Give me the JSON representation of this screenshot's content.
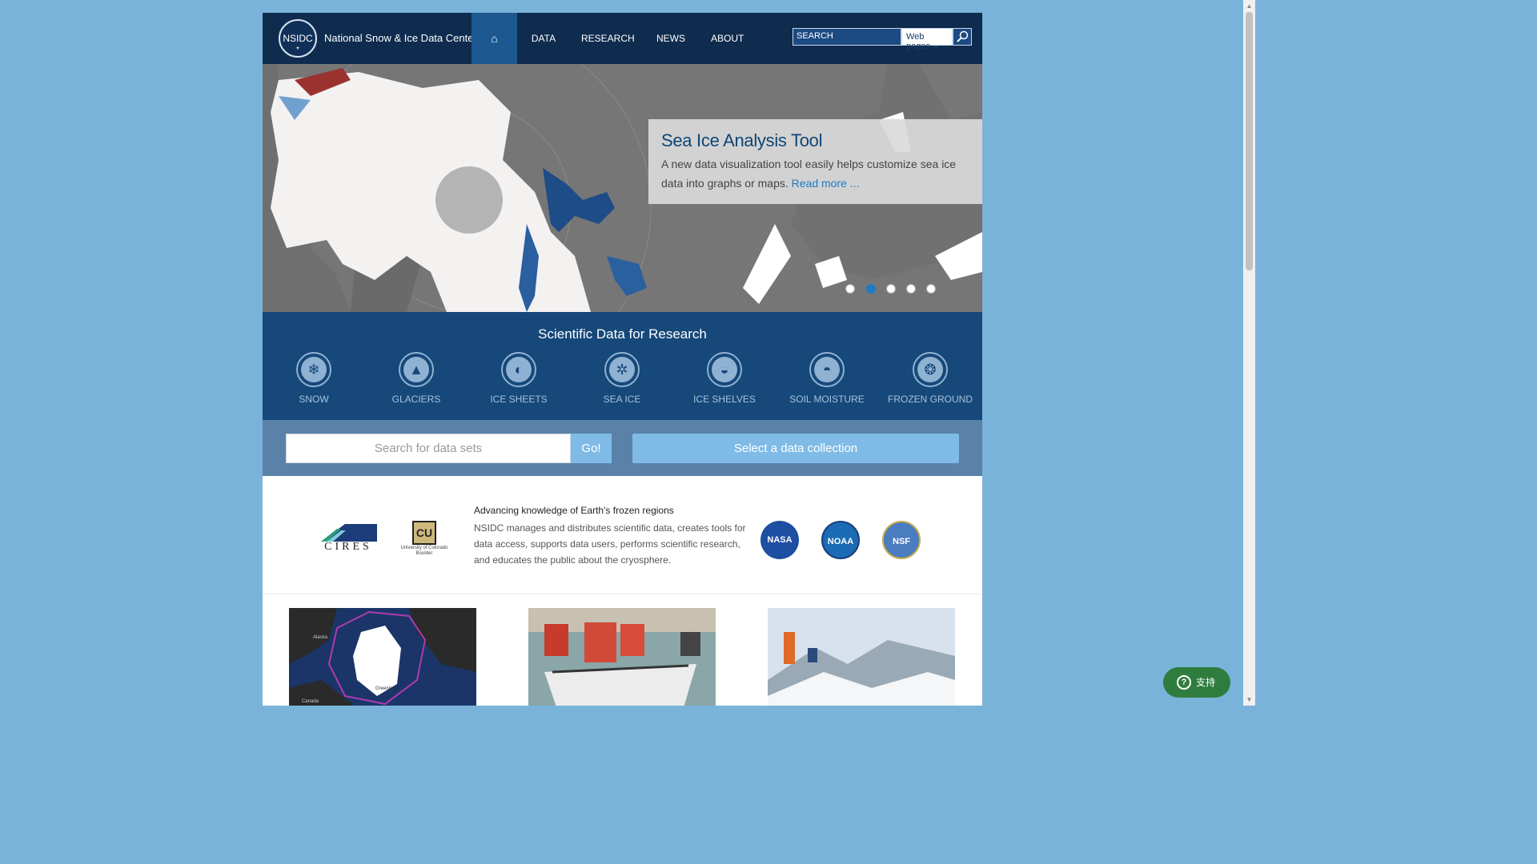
{
  "header": {
    "logo_text": "NSIDC",
    "logo_star": "*",
    "title": "National Snow & Ice Data Center",
    "nav": [
      {
        "label": "⌂",
        "icon": "home-icon"
      },
      {
        "label": "DATA"
      },
      {
        "label": "RESEARCH"
      },
      {
        "label": "NEWS"
      },
      {
        "label": "ABOUT"
      }
    ],
    "search_placeholder": "SEARCH",
    "search_scope": "Web pages"
  },
  "hero": {
    "title": "Sea Ice Analysis Tool",
    "text": "A new data visualization tool easily helps customize sea ice data into graphs or maps.",
    "link": "Read more ...",
    "active_slide": 2,
    "slides": 5
  },
  "science": {
    "title": "Scientific Data for Research",
    "categories": [
      {
        "label": "SNOW",
        "icon": "snowflake-icon"
      },
      {
        "label": "GLACIERS",
        "icon": "glacier-icon"
      },
      {
        "label": "ICE SHEETS",
        "icon": "ice-sheet-icon"
      },
      {
        "label": "SEA ICE",
        "icon": "sea-ice-icon"
      },
      {
        "label": "ICE SHELVES",
        "icon": "ice-shelf-icon"
      },
      {
        "label": "SOIL MOISTURE",
        "icon": "soil-moisture-icon"
      },
      {
        "label": "FROZEN GROUND",
        "icon": "frozen-ground-icon"
      }
    ]
  },
  "dataset_search": {
    "placeholder": "Search for data sets",
    "go_label": "Go!",
    "collection_label": "Select a data collection"
  },
  "about": {
    "heading": "Advancing knowledge of Earth's frozen regions",
    "text": "NSIDC manages and distributes scientific data, creates tools for data access, supports data users, performs scientific research, and educates the public about the cryosphere.",
    "partners": {
      "cires": "CIRES",
      "cu_mark": "CU",
      "cu_sub": "University of Colorado Boulder",
      "nasa": "NASA",
      "noaa": "NOAA",
      "nsf": "NSF"
    }
  },
  "features": {
    "map_labels": [
      "Alaska",
      "Greenland",
      "Canada"
    ]
  },
  "support": {
    "icon": "?",
    "label": "支持"
  },
  "colors": {
    "background": "#7ab3d9",
    "header": "#0f2c4f",
    "nav_active": "#1d5890",
    "science_band": "#16487a",
    "search_band": "#5a82a8",
    "button": "#7fbbe6",
    "link": "#1e7ac4",
    "support": "#2f7d3e"
  }
}
